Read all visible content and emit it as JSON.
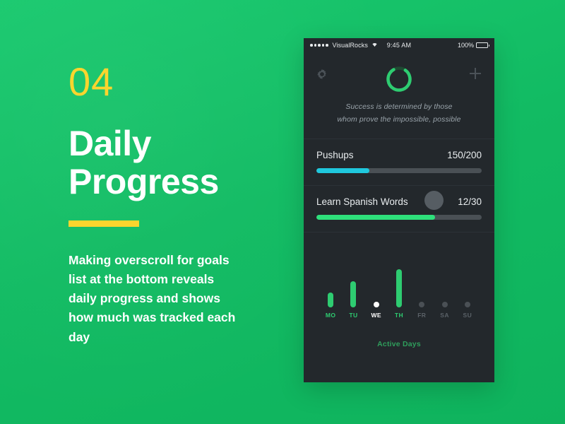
{
  "left_panel": {
    "step_number": "04",
    "headline_lines": [
      "Daily",
      "Progress"
    ],
    "body_copy": "Making overscroll for goals list at the bottom reveals daily progress and shows how much was tracked each day",
    "accent_color": "#fbd52e",
    "background_color": "#14c268"
  },
  "phone": {
    "status_bar": {
      "carrier": "VisualRocks",
      "wifi_icon": "wifi-icon",
      "time": "9:45 AM",
      "battery_percent": "100%",
      "battery_level": 100,
      "signal_dots": 5
    },
    "header": {
      "settings_icon": "gear-icon",
      "add_icon": "plus-icon",
      "ring_progress_percent": 82,
      "ring_color": "#2ecc71",
      "ring_track_color": "#1f4a32"
    },
    "quote": {
      "line1": "Success is determined by those",
      "line2": "whom prove the impossible, possible"
    },
    "goals": [
      {
        "title": "Pushups",
        "count_label": "150/200",
        "current": 150,
        "target": 200,
        "percent": 32,
        "fill_color": "#1fc8dd",
        "has_handle": false
      },
      {
        "title": "Learn Spanish Words",
        "count_label": "12/30",
        "current": 12,
        "target": 30,
        "percent": 72,
        "fill_color": "#2ee07b",
        "has_handle": true
      }
    ],
    "chart_data": {
      "type": "bar",
      "title": "Active Days",
      "categories": [
        "MO",
        "TU",
        "WE",
        "TH",
        "FR",
        "SA",
        "SU"
      ],
      "values": [
        22,
        40,
        0,
        58,
        0,
        0,
        0
      ],
      "states": [
        "active",
        "active",
        "today",
        "active",
        "inactive",
        "inactive",
        "inactive"
      ],
      "xlabel": "",
      "ylabel": "",
      "ylim": [
        0,
        58
      ],
      "grid": false,
      "legend": "none",
      "active_color": "#2ecc71",
      "today_color": "#ffffff",
      "inactive_color": "#4a5055",
      "caption_color": "#2f9e5c"
    }
  }
}
